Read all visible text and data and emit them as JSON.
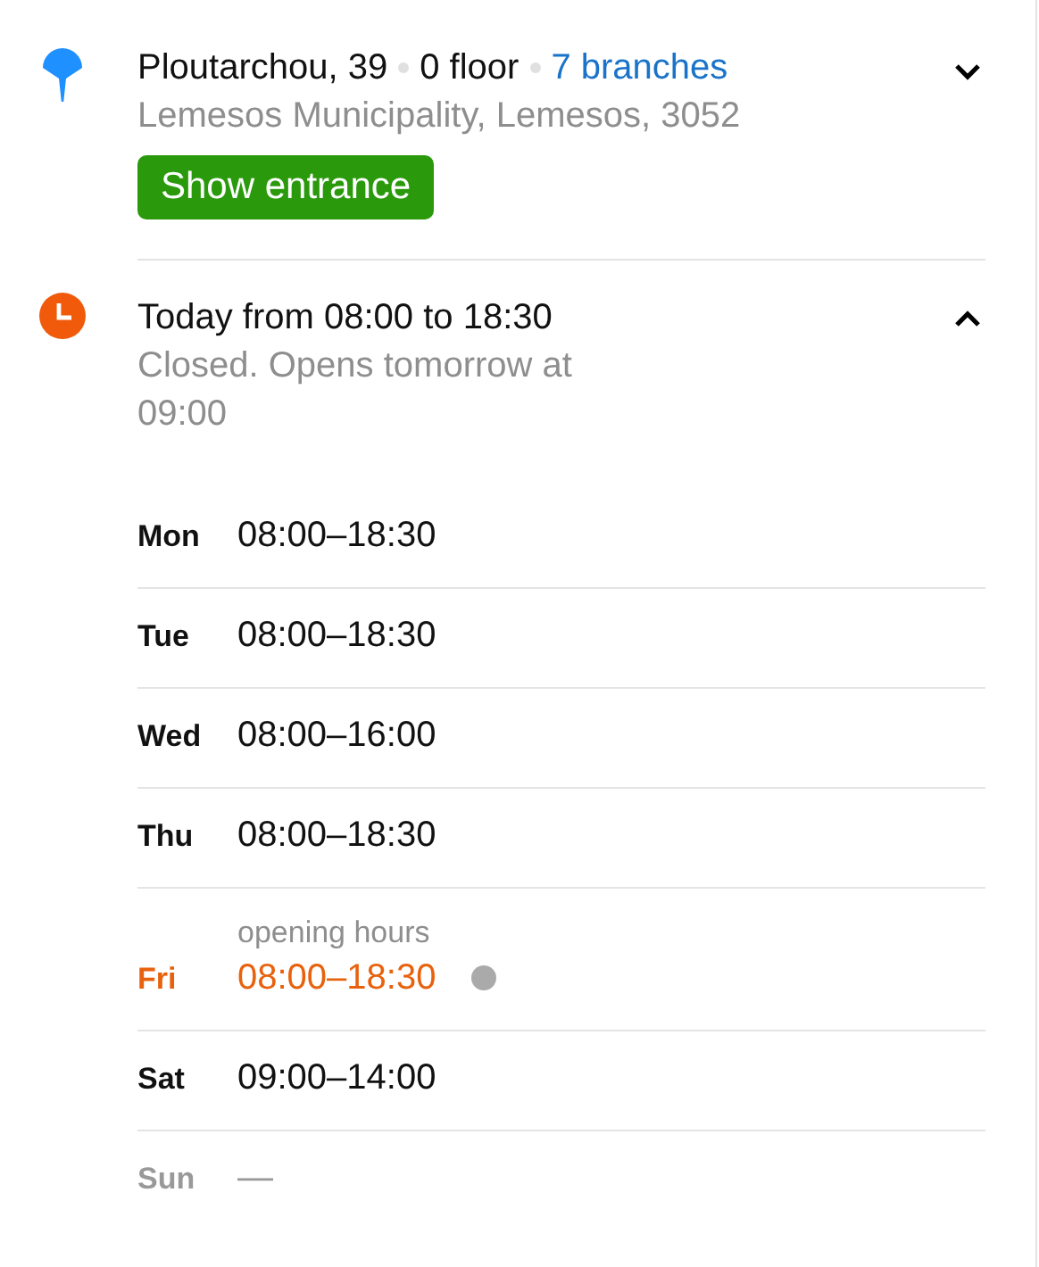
{
  "address": {
    "street": "Ploutarchou, 39",
    "floor": "0 floor",
    "branches": "7 branches",
    "locality": "Lemesos Municipality, Lemesos, 3052",
    "button": "Show entrance",
    "expanded": false
  },
  "hours": {
    "summary": "Today from 08:00 to 18:30",
    "status": "Closed. Opens tomorrow at 09:00",
    "expanded": true,
    "days": [
      {
        "day": "Mon",
        "time": "08:00–18:30",
        "today": false,
        "closed": false,
        "dot": false
      },
      {
        "day": "Tue",
        "time": "08:00–18:30",
        "today": false,
        "closed": false,
        "dot": false
      },
      {
        "day": "Wed",
        "time": "08:00–16:00",
        "today": false,
        "closed": false,
        "dot": false
      },
      {
        "day": "Thu",
        "time": "08:00–18:30",
        "today": false,
        "closed": false,
        "dot": false
      },
      {
        "day": "Fri",
        "time": "08:00–18:30",
        "note": "opening hours",
        "today": true,
        "closed": false,
        "dot": true
      },
      {
        "day": "Sat",
        "time": "09:00–14:00",
        "today": false,
        "closed": false,
        "dot": false
      },
      {
        "day": "Sun",
        "time": "—",
        "today": false,
        "closed": true,
        "dot": false
      }
    ]
  }
}
